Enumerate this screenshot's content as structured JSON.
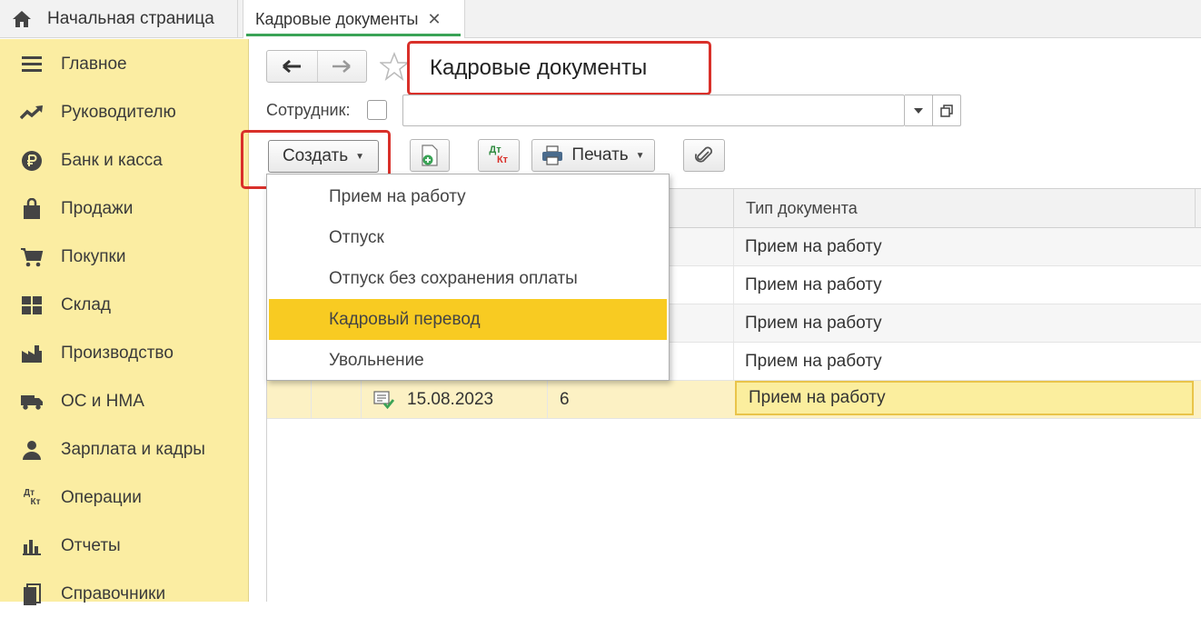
{
  "tabs": {
    "home_label": "Начальная страница",
    "active_label": "Кадровые документы",
    "close_glyph": "✕"
  },
  "sidebar": {
    "items": [
      {
        "label": "Главное",
        "icon": "menu-icon"
      },
      {
        "label": "Руководителю",
        "icon": "trend-up-icon"
      },
      {
        "label": "Банк и касса",
        "icon": "ruble-coin-icon"
      },
      {
        "label": "Продажи",
        "icon": "shopping-bag-icon"
      },
      {
        "label": "Покупки",
        "icon": "cart-icon"
      },
      {
        "label": "Склад",
        "icon": "warehouse-grid-icon"
      },
      {
        "label": "Производство",
        "icon": "factory-icon"
      },
      {
        "label": "ОС и НМА",
        "icon": "truck-icon"
      },
      {
        "label": "Зарплата и кадры",
        "icon": "person-icon"
      },
      {
        "label": "Операции",
        "icon": "dt-kt-icon"
      },
      {
        "label": "Отчеты",
        "icon": "bar-chart-icon"
      },
      {
        "label": "Справочники",
        "icon": "books-icon"
      }
    ],
    "dtkt_top": "Дт",
    "dtkt_bottom": "Кт"
  },
  "header": {
    "title": "Кадровые документы",
    "back_glyph": "🡐",
    "forward_glyph": "🡒"
  },
  "filter": {
    "employee_label": "Сотрудник:",
    "employee_value": ""
  },
  "toolbar": {
    "create_label": "Создать",
    "print_label": "Печать",
    "dt": "Дт",
    "kt": "Кт"
  },
  "table": {
    "columns": [
      "Тип документа"
    ],
    "rows": [
      {
        "date": "",
        "number": "",
        "type": "Прием на работу"
      },
      {
        "date": "",
        "number": "",
        "type": "Прием на работу"
      },
      {
        "date": "",
        "number": "",
        "type": "Прием на работу"
      },
      {
        "date": "",
        "number": "",
        "type": "Прием на работу"
      },
      {
        "date": "15.08.2023",
        "number": "6",
        "type": "Прием на работу"
      }
    ]
  },
  "create_menu": {
    "items": [
      "Прием на работу",
      "Отпуск",
      "Отпуск без сохранения оплаты",
      "Кадровый перевод",
      "Увольнение"
    ],
    "highlighted_index": 3
  },
  "colors": {
    "sidebar_bg": "#fbeda2",
    "highlight": "#f8cb22",
    "annotation_red": "#d9302a",
    "active_tab_underline": "#3aa356"
  }
}
